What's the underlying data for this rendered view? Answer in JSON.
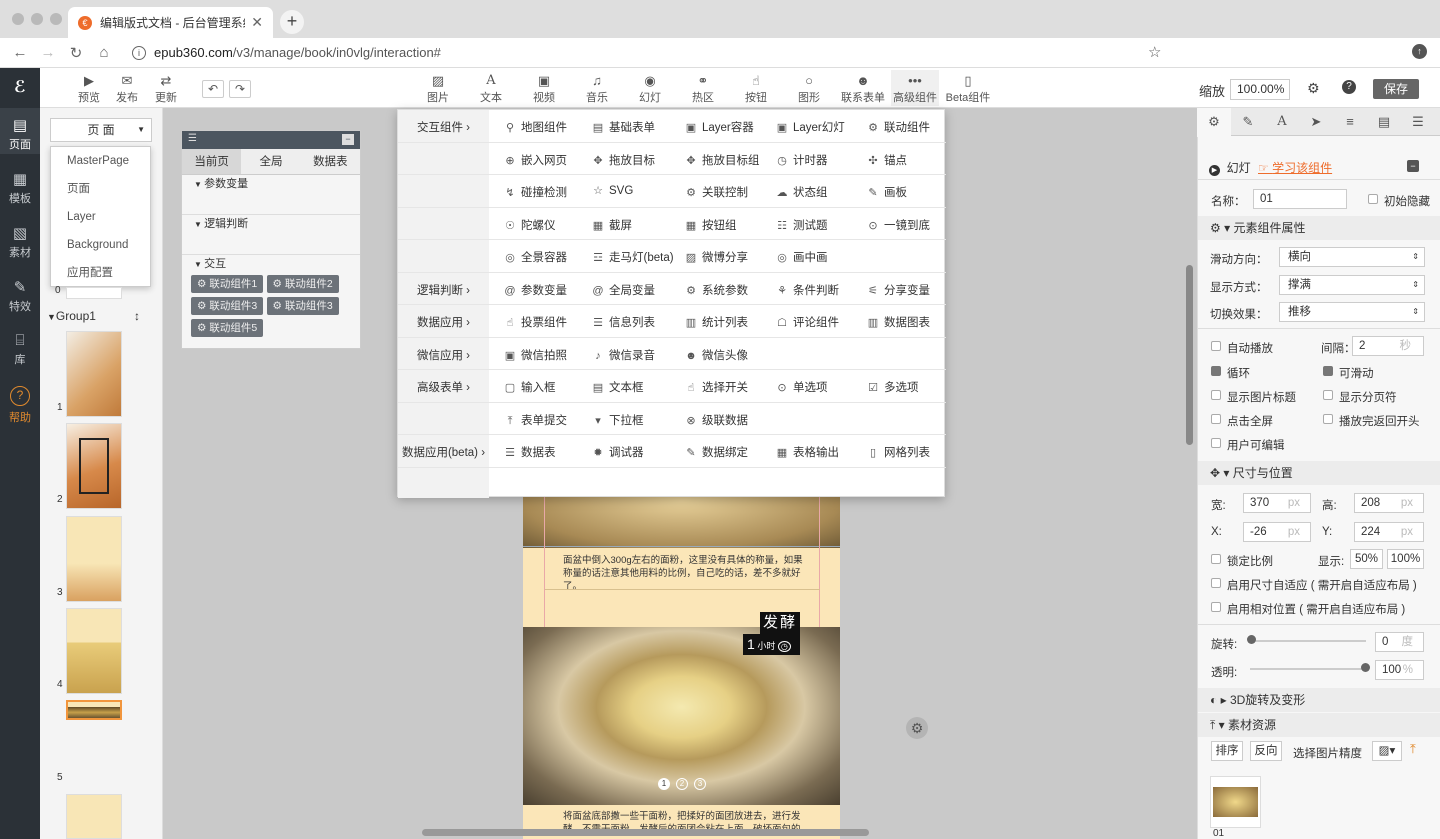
{
  "browser": {
    "tab_title": "编辑版式文档 - 后台管理系统",
    "url_host": "epub360.com",
    "url_path": "/v3/manage/book/in0vlg/interaction#"
  },
  "leftnav": {
    "logo": "ℰ",
    "items": [
      {
        "label": "页面",
        "icon": "page-icon"
      },
      {
        "label": "模板",
        "icon": "template-icon"
      },
      {
        "label": "素材",
        "icon": "material-icon"
      },
      {
        "label": "特效",
        "icon": "effect-icon"
      },
      {
        "label": "库",
        "icon": "library-icon"
      },
      {
        "label": "帮助",
        "icon": "help-icon"
      }
    ]
  },
  "toolbar": {
    "left": [
      "预览",
      "发布",
      "更新"
    ],
    "tools": [
      "图片",
      "文本",
      "视频",
      "音乐",
      "幻灯",
      "热区",
      "按钮",
      "图形",
      "联系表单",
      "高级组件",
      "Beta组件"
    ],
    "zoom_label": "缩放",
    "zoom_value": "100.00%",
    "save": "保存"
  },
  "pages": {
    "selector": "页 面",
    "menu": [
      "MasterPage",
      "页面",
      "Layer",
      "Background",
      "应用配置"
    ],
    "group": "Group1",
    "thumbs": [
      "1",
      "2",
      "3",
      "4",
      "5"
    ],
    "zero": "0"
  },
  "vars": {
    "tabs": [
      "当前页",
      "全局",
      "数据表"
    ],
    "sections": [
      "参数变量",
      "逻辑判断",
      "交互"
    ],
    "chips": [
      "联动组件1",
      "联动组件2",
      "联动组件3",
      "联动组件3",
      "联动组件5"
    ]
  },
  "popup": {
    "rows": [
      {
        "cat": "交互组件",
        "items": [
          "地图组件",
          "基础表单",
          "Layer容器",
          "Layer幻灯",
          "联动组件"
        ]
      },
      {
        "cat": "",
        "items": [
          "嵌入网页",
          "拖放目标",
          "拖放目标组",
          "计时器",
          "锚点"
        ]
      },
      {
        "cat": "",
        "items": [
          "碰撞检测",
          "SVG",
          "关联控制",
          "状态组",
          "画板"
        ]
      },
      {
        "cat": "",
        "items": [
          "陀螺仪",
          "截屏",
          "按钮组",
          "测试题",
          "一镜到底"
        ]
      },
      {
        "cat": "",
        "items": [
          "全景容器",
          "走马灯(beta)",
          "微博分享",
          "画中画",
          ""
        ]
      },
      {
        "cat": "逻辑判断",
        "items": [
          "参数变量",
          "全局变量",
          "系统参数",
          "条件判断",
          "分享变量"
        ]
      },
      {
        "cat": "数据应用",
        "items": [
          "投票组件",
          "信息列表",
          "统计列表",
          "评论组件",
          "数据图表"
        ]
      },
      {
        "cat": "微信应用",
        "items": [
          "微信拍照",
          "微信录音",
          "微信头像",
          "",
          ""
        ]
      },
      {
        "cat": "高级表单",
        "items": [
          "输入框",
          "文本框",
          "选择开关",
          "单选项",
          "多选项"
        ]
      },
      {
        "cat": "",
        "items": [
          "表单提交",
          "下拉框",
          "级联数据",
          "",
          ""
        ]
      },
      {
        "cat": "数据应用(beta)",
        "items": [
          "数据表",
          "调试器",
          "数据绑定",
          "表格输出",
          "网格列表"
        ]
      }
    ]
  },
  "canvas": {
    "text1": "面盆中倒入300g左右的面粉，这里没有具体的称量，如果称量的话注意其他用料的比例，自己吃的话，差不多就好了。",
    "badge_title": "发酵",
    "badge_time_num": "1",
    "badge_time_unit": "小时",
    "dots": [
      "1",
      "2",
      "3"
    ],
    "text2": "将面盆底部撒一些干面粉，把揉好的面团放进去，进行发酵，不需干面粉，发酵后的面团会粘在上面，破坏面包的"
  },
  "right": {
    "comp_name": "幻灯",
    "learn": "学习该组件",
    "name_label": "名称：",
    "name_value": "01",
    "hide_label": "初始隐藏",
    "sec_props": "元素组件属性",
    "slide_dir_label": "滑动方向：",
    "slide_dir": "横向",
    "display_label": "显示方式：",
    "display": "撑满",
    "switch_label": "切换效果：",
    "switch": "推移",
    "autoplay": "自动播放",
    "interval_label": "间隔：",
    "interval": "2",
    "interval_unit": "秒",
    "loop": "循环",
    "swipe": "可滑动",
    "show_title": "显示图片标题",
    "show_pager": "显示分页符",
    "fullscreen": "点击全屏",
    "return_start": "播放完返回开头",
    "user_edit": "用户可编辑",
    "sec_size": "尺寸与位置",
    "w_label": "宽:",
    "w": "370",
    "h_label": "高:",
    "h": "208",
    "x_label": "X:",
    "x": "-26",
    "y_label": "Y:",
    "y": "224",
    "px": "px",
    "lock_ratio": "锁定比例",
    "show_label": "显示:",
    "show50": "50%",
    "show100": "100%",
    "auto_size": "启用尺寸自适应 ( 需开启自适应布局 )",
    "rel_pos": "启用相对位置 ( 需开启自适应布局 )",
    "rotate_label": "旋转:",
    "rotate": "0",
    "deg": "度",
    "opacity_label": "透明:",
    "opacity": "100",
    "pct": "%",
    "sec_3d": "3D旋转及变形",
    "sec_res": "素材资源",
    "sort": "排序",
    "reverse": "反向",
    "precision": "选择图片精度",
    "thumb_label": "01"
  },
  "colors": {
    "accent": "#ee6c2b",
    "dark": "#2b3137"
  }
}
